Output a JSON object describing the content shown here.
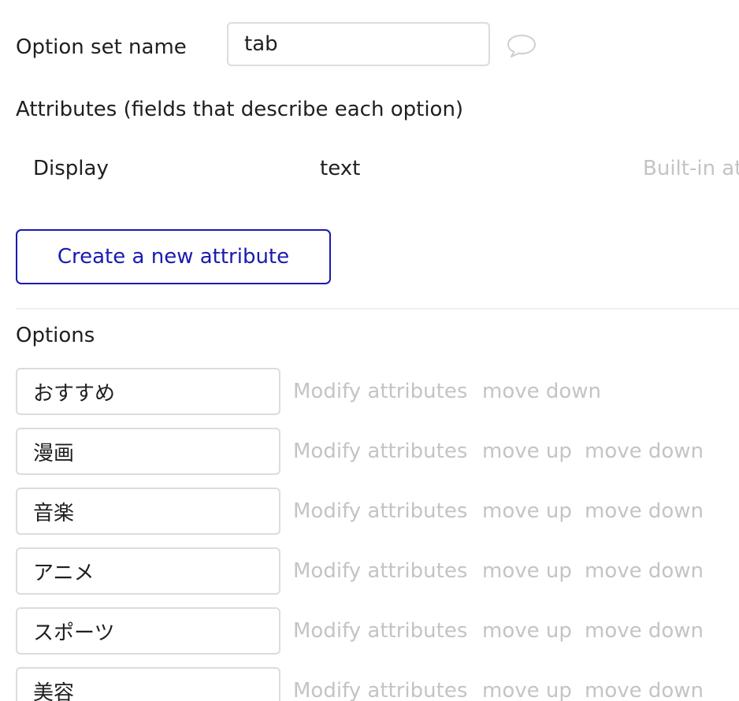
{
  "option_set": {
    "name_label": "Option set name",
    "name_value": "tab",
    "comment_icon": "speech-bubble-icon"
  },
  "attributes": {
    "heading": "Attributes (fields that describe each option)",
    "items": [
      {
        "name": "Display",
        "type": "text",
        "note": "Built-in at"
      }
    ],
    "create_button_label": "Create a new attribute"
  },
  "options": {
    "heading": "Options",
    "modify_label": "Modify attributes",
    "move_up_label": "move up",
    "move_down_label": "move down",
    "items": [
      {
        "value": "おすすめ"
      },
      {
        "value": "漫画"
      },
      {
        "value": "音楽"
      },
      {
        "value": "アニメ"
      },
      {
        "value": "スポーツ"
      },
      {
        "value": "美容"
      }
    ]
  },
  "colors": {
    "accent": "#1a1ab0",
    "muted_text": "#c4c4c4",
    "border": "#dcdcdc"
  }
}
